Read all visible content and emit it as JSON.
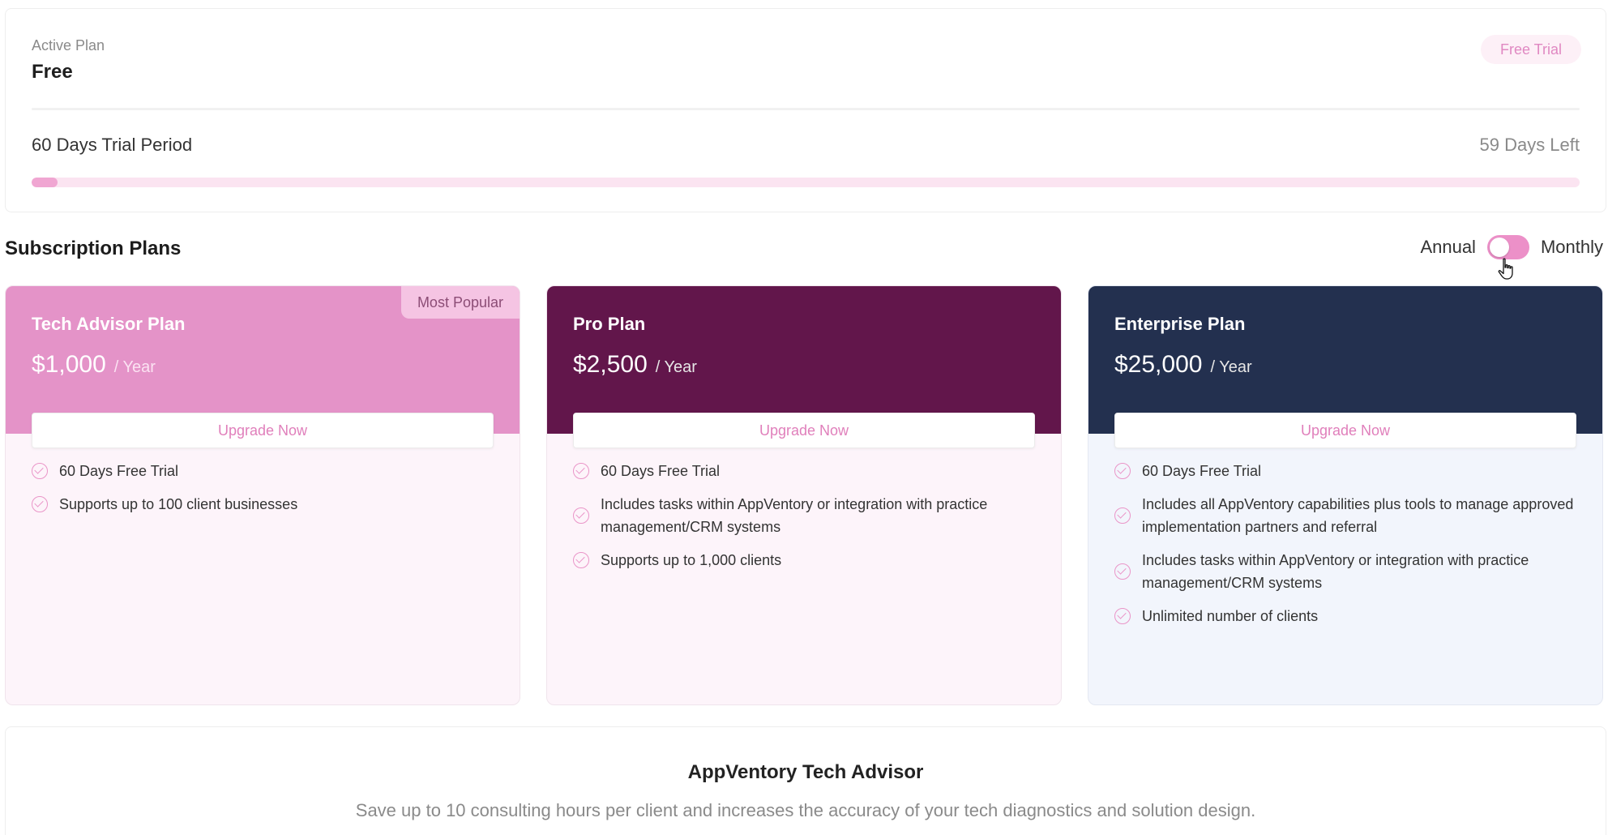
{
  "active_plan": {
    "label": "Active Plan",
    "value": "Free",
    "badge": "Free Trial",
    "trial_period": "60 Days Trial Period",
    "days_left": "59 Days Left",
    "progress_fraction": 0.017
  },
  "subscription": {
    "title": "Subscription Plans",
    "toggle_left_label": "Annual",
    "toggle_right_label": "Monthly"
  },
  "plans": [
    {
      "name": "Tech Advisor Plan",
      "price": "$1,000",
      "period": "/ Year",
      "badge": "Most Popular",
      "button": "Upgrade Now",
      "features": [
        "60 Days Free Trial",
        "Supports up to 100 client businesses"
      ]
    },
    {
      "name": "Pro Plan",
      "price": "$2,500",
      "period": "/ Year",
      "button": "Upgrade Now",
      "features": [
        "60 Days Free Trial",
        "Includes tasks within AppVentory or integration with practice management/CRM systems",
        "Supports up to 1,000 clients"
      ]
    },
    {
      "name": "Enterprise Plan",
      "price": "$25,000",
      "period": "/ Year",
      "button": "Upgrade Now",
      "features": [
        "60 Days Free Trial",
        "Includes all AppVentory capabilities plus tools to manage approved implementation partners and referral",
        "Includes tasks within AppVentory or integration with practice management/CRM systems",
        "Unlimited number of clients"
      ]
    }
  ],
  "advisor": {
    "title": "AppVentory Tech Advisor",
    "description": "Save up to 10 consulting hours per client and increases the accuracy of your tech diagnostics and solution design."
  },
  "colors": {
    "accent_pink": "#e493c8",
    "pro_header": "#62164b",
    "enterprise_header": "#23304f",
    "check_pink": "#ea95c8"
  },
  "icons": {
    "feature_check": "check-circle-icon",
    "cursor": "hand-pointer-icon"
  }
}
